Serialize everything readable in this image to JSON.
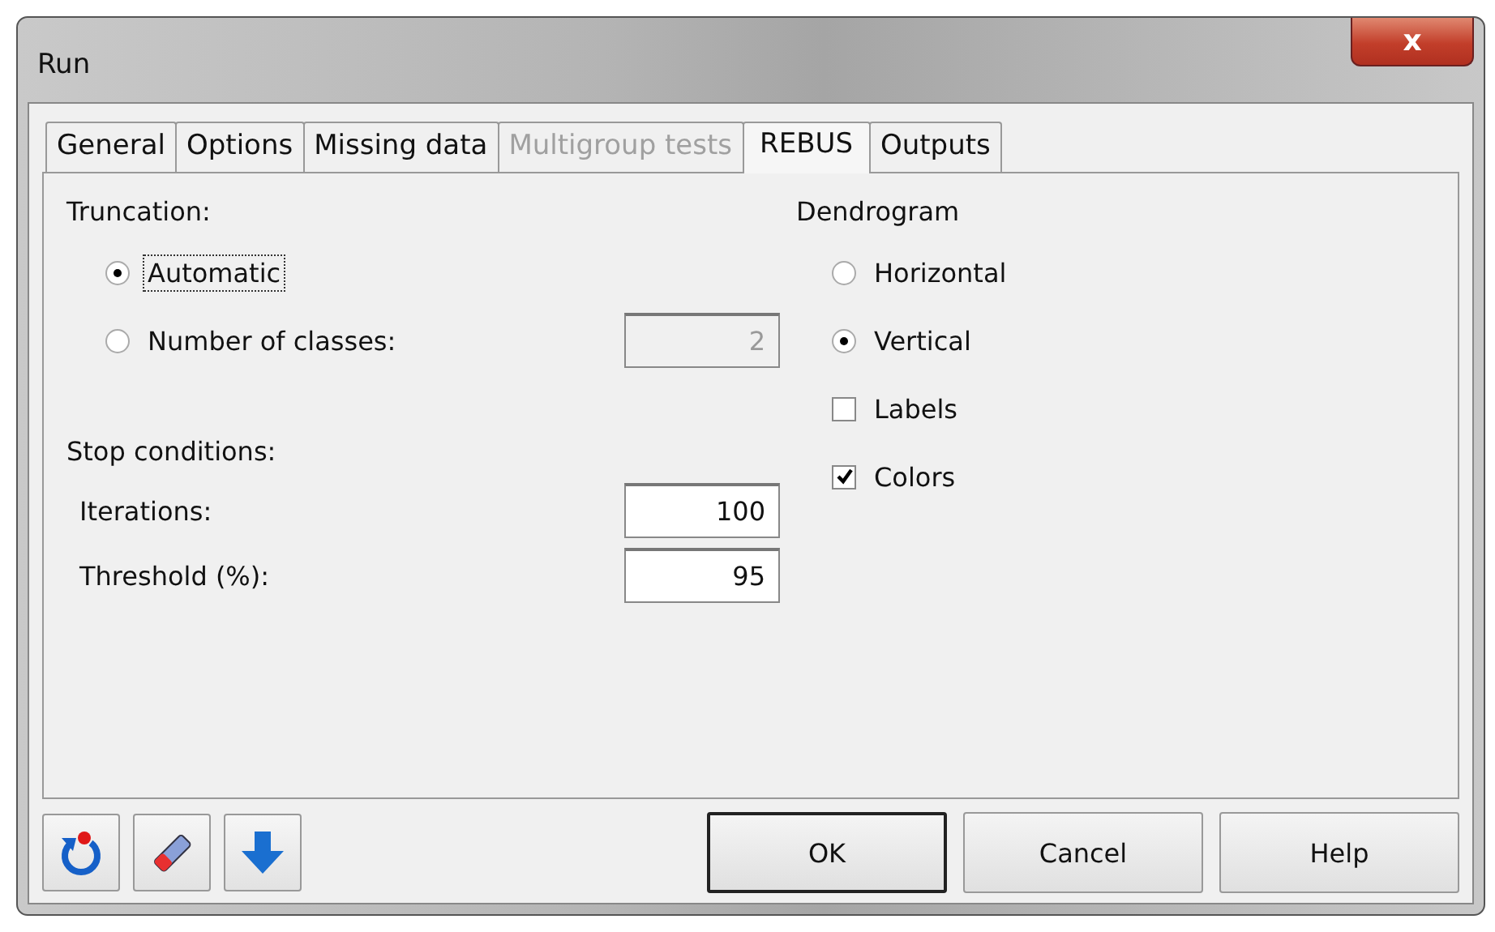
{
  "window": {
    "title": "Run",
    "close_label": "x"
  },
  "tabs": [
    {
      "label": "General",
      "selected": false,
      "disabled": false
    },
    {
      "label": "Options",
      "selected": false,
      "disabled": false
    },
    {
      "label": "Missing data",
      "selected": false,
      "disabled": false
    },
    {
      "label": "Multigroup tests",
      "selected": false,
      "disabled": true
    },
    {
      "label": "REBUS",
      "selected": true,
      "disabled": false
    },
    {
      "label": "Outputs",
      "selected": false,
      "disabled": false
    }
  ],
  "truncation": {
    "label": "Truncation:",
    "options": [
      {
        "label": "Automatic",
        "selected": true,
        "focused": true
      },
      {
        "label": "Number of classes:",
        "selected": false,
        "focused": false
      }
    ],
    "classes_field": {
      "value": "2",
      "disabled": true
    }
  },
  "stop_conditions": {
    "label": "Stop conditions:",
    "fields": [
      {
        "label": "Iterations:",
        "value": "100"
      },
      {
        "label": "Threshold (%):",
        "value": "95"
      }
    ]
  },
  "dendrogram": {
    "label": "Dendrogram",
    "items": [
      {
        "kind": "radio",
        "label": "Horizontal",
        "selected": false
      },
      {
        "kind": "radio",
        "label": "Vertical",
        "selected": true
      },
      {
        "kind": "checkbox",
        "label": "Labels",
        "checked": false
      },
      {
        "kind": "checkbox",
        "label": "Colors",
        "checked": true
      }
    ]
  },
  "tool_buttons": [
    {
      "kind": "reset"
    },
    {
      "kind": "eraser"
    },
    {
      "kind": "down"
    }
  ],
  "buttons": [
    {
      "label": "OK",
      "default": true
    },
    {
      "label": "Cancel",
      "default": false
    },
    {
      "label": "Help",
      "default": false
    }
  ]
}
